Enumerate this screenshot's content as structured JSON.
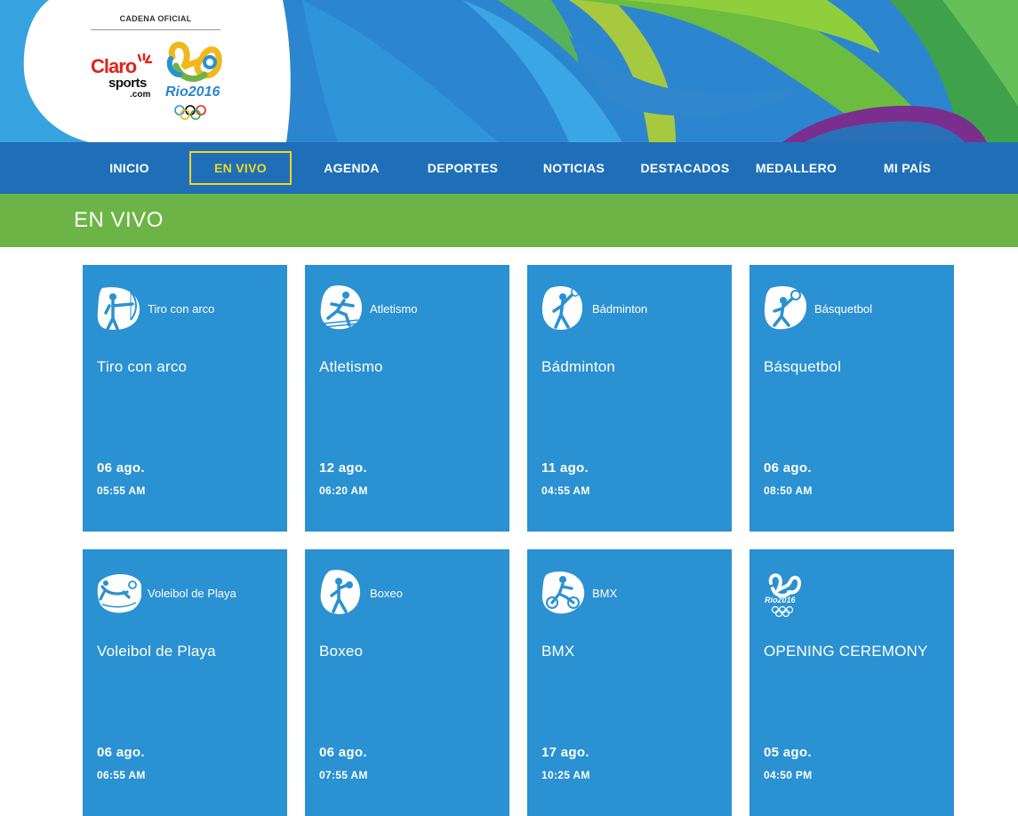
{
  "header": {
    "cadena_label": "CADENA OFICIAL",
    "claro_main": "Claro",
    "claro_sports": "sports",
    "claro_com": ".com",
    "rio_text": "Rio2016",
    "colors": {
      "blue": "#2c86cf",
      "green": "#6db446",
      "yellow": "#f1d81b"
    }
  },
  "nav": {
    "items": [
      {
        "label": "INICIO"
      },
      {
        "label": "EN VIVO",
        "active": true
      },
      {
        "label": "AGENDA"
      },
      {
        "label": "DEPORTES"
      },
      {
        "label": "NOTICIAS"
      },
      {
        "label": "DESTACADOS"
      },
      {
        "label": "MEDALLERO"
      },
      {
        "label": "MI PAÍS"
      }
    ]
  },
  "section": {
    "title": "EN VIVO"
  },
  "cards": [
    {
      "icon": "archery-icon",
      "tag": "Tiro con arco",
      "name": "Tiro con arco",
      "date": "06 ago.",
      "time": "05:55 AM"
    },
    {
      "icon": "athletics-icon",
      "tag": "Atletismo",
      "name": "Atletismo",
      "date": "12 ago.",
      "time": "06:20 AM"
    },
    {
      "icon": "badminton-icon",
      "tag": "Bádminton",
      "name": "Bádminton",
      "date": "11 ago.",
      "time": "04:55 AM"
    },
    {
      "icon": "basketball-icon",
      "tag": "Básquetbol",
      "name": "Básquetbol",
      "date": "06 ago.",
      "time": "08:50 AM"
    },
    {
      "icon": "beach-volleyball-icon",
      "tag": "Voleibol de Playa",
      "name": "Voleibol de Playa",
      "date": "06 ago.",
      "time": "06:55 AM"
    },
    {
      "icon": "boxing-icon",
      "tag": "Boxeo",
      "name": "Boxeo",
      "date": "06 ago.",
      "time": "07:55 AM"
    },
    {
      "icon": "bmx-icon",
      "tag": "BMX",
      "name": "BMX",
      "date": "17 ago.",
      "time": "10:25 AM"
    },
    {
      "icon": "rio2016-logo-icon",
      "tag": "",
      "rio_text": "Rio2016",
      "name": "OPENING CEREMONY",
      "date": "05 ago.",
      "time": "04:50 PM"
    }
  ]
}
